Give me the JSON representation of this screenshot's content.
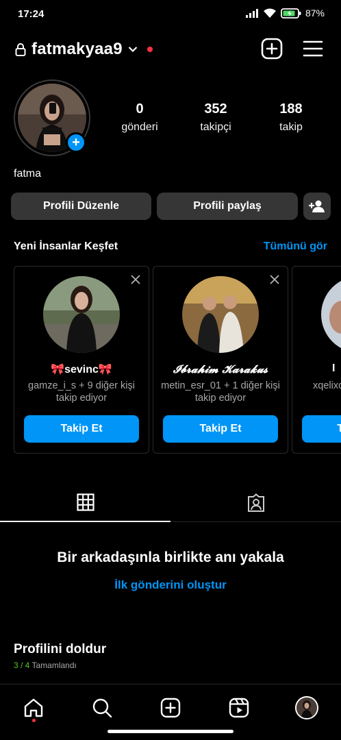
{
  "status_bar": {
    "time": "17:24",
    "battery": "87%"
  },
  "header": {
    "username": "fatmakyaa9"
  },
  "profile": {
    "display_name": "fatma",
    "stats": [
      {
        "value": "0",
        "label": "gönderi"
      },
      {
        "value": "352",
        "label": "takipçi"
      },
      {
        "value": "188",
        "label": "takip"
      }
    ],
    "edit_button": "Profili Düzenle",
    "share_button": "Profili paylaş"
  },
  "discover": {
    "title": "Yeni İnsanlar Keşfet",
    "see_all": "Tümünü gör",
    "cards": [
      {
        "name": "🎀sevinc🎀",
        "subtitle": "gamze_i_s + 9 diğer kişi takip ediyor",
        "follow": "Takip Et"
      },
      {
        "name": "𝓘𝓫𝓻𝓪𝓱𝓲𝓶 𝓚𝓪𝓻𝓪𝓴𝓾𝓼",
        "subtitle": "metin_esr_01 + 1 diğer kişi takip ediyor",
        "follow": "Takip Et"
      },
      {
        "name": "I",
        "subtitle": "xqelixc",
        "follow": "T"
      }
    ]
  },
  "empty_state": {
    "title": "Bir arkadaşınla birlikte anı yakala",
    "link": "İlk gönderini oluştur"
  },
  "complete_profile": {
    "title": "Profilini doldur",
    "progress": "3 / 4",
    "progress_label": "Tamamlandı"
  },
  "colors": {
    "accent": "#0095f6",
    "notification": "#ff3040",
    "progress": "#58c322"
  }
}
